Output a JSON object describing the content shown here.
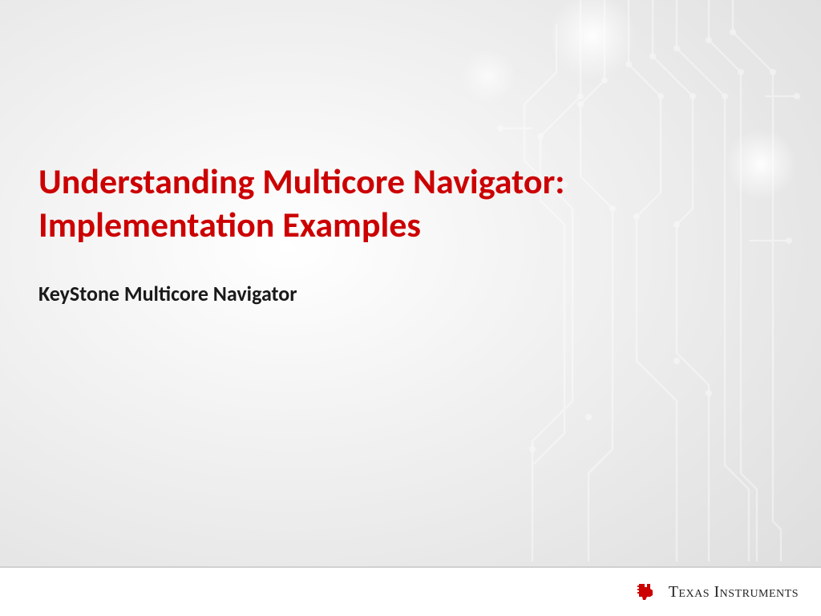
{
  "slide": {
    "title_line1": "Understanding Multicore Navigator:",
    "title_line2": "Implementation Examples",
    "subtitle": "KeyStone Multicore Navigator"
  },
  "footer": {
    "company": "Texas Instruments"
  },
  "colors": {
    "title": "#cc0000",
    "subtitle": "#1a1a1a",
    "logo_red": "#cc0000"
  }
}
